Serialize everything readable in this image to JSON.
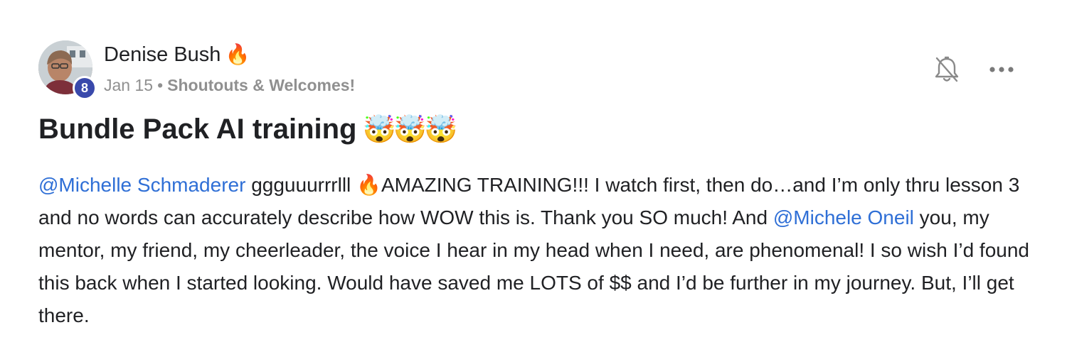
{
  "post": {
    "author": {
      "name": "Denise Bush",
      "name_emoji": "🔥",
      "level": "8",
      "avatar": "avatar-photo"
    },
    "meta": {
      "date": "Jan 15",
      "separator": "•",
      "category": "Shoutouts & Welcomes!"
    },
    "actions": {
      "bell_icon": "bell-off-icon",
      "more_icon": "more-horizontal-icon"
    },
    "title": "Bundle Pack AI training",
    "title_emoji": "🤯🤯🤯",
    "body": {
      "mention_1": "@Michelle Schmaderer",
      "text_1": " ggguuurrrlll ",
      "emoji_1": "🔥",
      "text_2": "AMAZING TRAINING!!! I watch first, then do…and I’m only thru lesson 3 and no words can accurately describe how WOW this is. Thank you SO much! And ",
      "mention_2": "@Michele Oneil",
      "text_3": " you, my mentor, my friend, my cheerleader, the voice I hear in my head when I need, are phenomenal! I so wish I’d found this back when I started looking. Would have saved me LOTS of $$ and I’d be further in my journey. But, I’ll get there."
    },
    "colors": {
      "mention": "#2f6fd6",
      "badge": "#3949ab",
      "meta_text": "#909090",
      "text": "#202124"
    }
  }
}
